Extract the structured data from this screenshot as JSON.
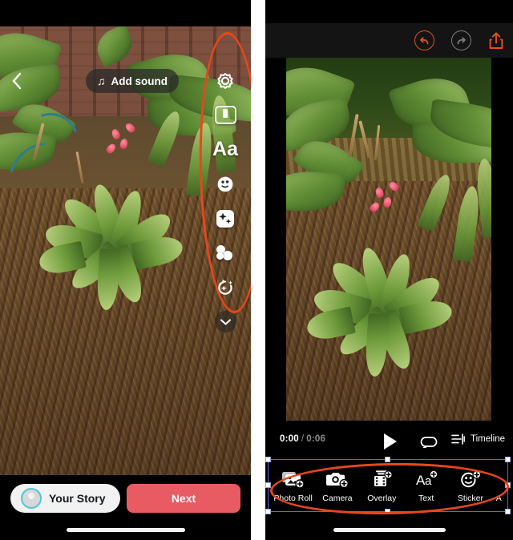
{
  "left_panel": {
    "name": "instagram-story-composer",
    "back_icon": "chevron-left-icon",
    "add_sound": {
      "label": "Add sound",
      "icon": "music-note-icon"
    },
    "tool_rail": [
      {
        "name": "settings",
        "icon": "gear-icon",
        "label": ""
      },
      {
        "name": "boomerang",
        "icon": "boomerang-icon",
        "label": ""
      },
      {
        "name": "text",
        "icon": "text-aa-icon",
        "label": "Aa"
      },
      {
        "name": "sticker",
        "icon": "sticker-smiley-icon",
        "label": ""
      },
      {
        "name": "effects",
        "icon": "sparkle-square-icon",
        "label": ""
      },
      {
        "name": "draw",
        "icon": "draw-dots-icon",
        "label": ""
      },
      {
        "name": "enhance",
        "icon": "camera-sparkle-icon",
        "label": ""
      },
      {
        "name": "more",
        "icon": "chevron-down-icon",
        "label": ""
      }
    ],
    "your_story_button": {
      "label": "Your Story",
      "avatar_ring_color": "#4ec8d8"
    },
    "next_button": {
      "label": "Next",
      "color": "#e85b63"
    }
  },
  "right_panel": {
    "name": "video-editor",
    "top_actions": [
      {
        "name": "undo",
        "icon": "undo-circle-icon",
        "color": "#e2521e",
        "enabled": true
      },
      {
        "name": "redo",
        "icon": "redo-circle-icon",
        "color": "#7d7d7d",
        "enabled": false
      },
      {
        "name": "export",
        "icon": "share-up-icon",
        "color": "#e2521e",
        "enabled": true
      }
    ],
    "playback": {
      "current_time": "0:00",
      "separator": "/",
      "total_time": "0:06",
      "play_icon": "play-triangle-icon",
      "loop_icon": "loop-icon",
      "timeline_icon": "timeline-icon",
      "timeline_label": "Timeline"
    },
    "tools": [
      {
        "label": "Photo Roll",
        "icon": "photo-roll-add-icon"
      },
      {
        "label": "Camera",
        "icon": "camera-add-icon"
      },
      {
        "label": "Overlay",
        "icon": "film-add-icon"
      },
      {
        "label": "Text",
        "icon": "text-add-icon"
      },
      {
        "label": "Sticker",
        "icon": "sticker-add-icon"
      },
      {
        "label": "A",
        "icon": "cut-off-icon"
      }
    ],
    "selection": {
      "color": "#5868d6",
      "handles": 8
    }
  },
  "annotations": {
    "color": "#e8471c",
    "shapes": [
      {
        "name": "left-toolbar-highlight",
        "type": "ellipse"
      },
      {
        "name": "right-toolstrip-highlight",
        "type": "ellipse"
      }
    ]
  }
}
